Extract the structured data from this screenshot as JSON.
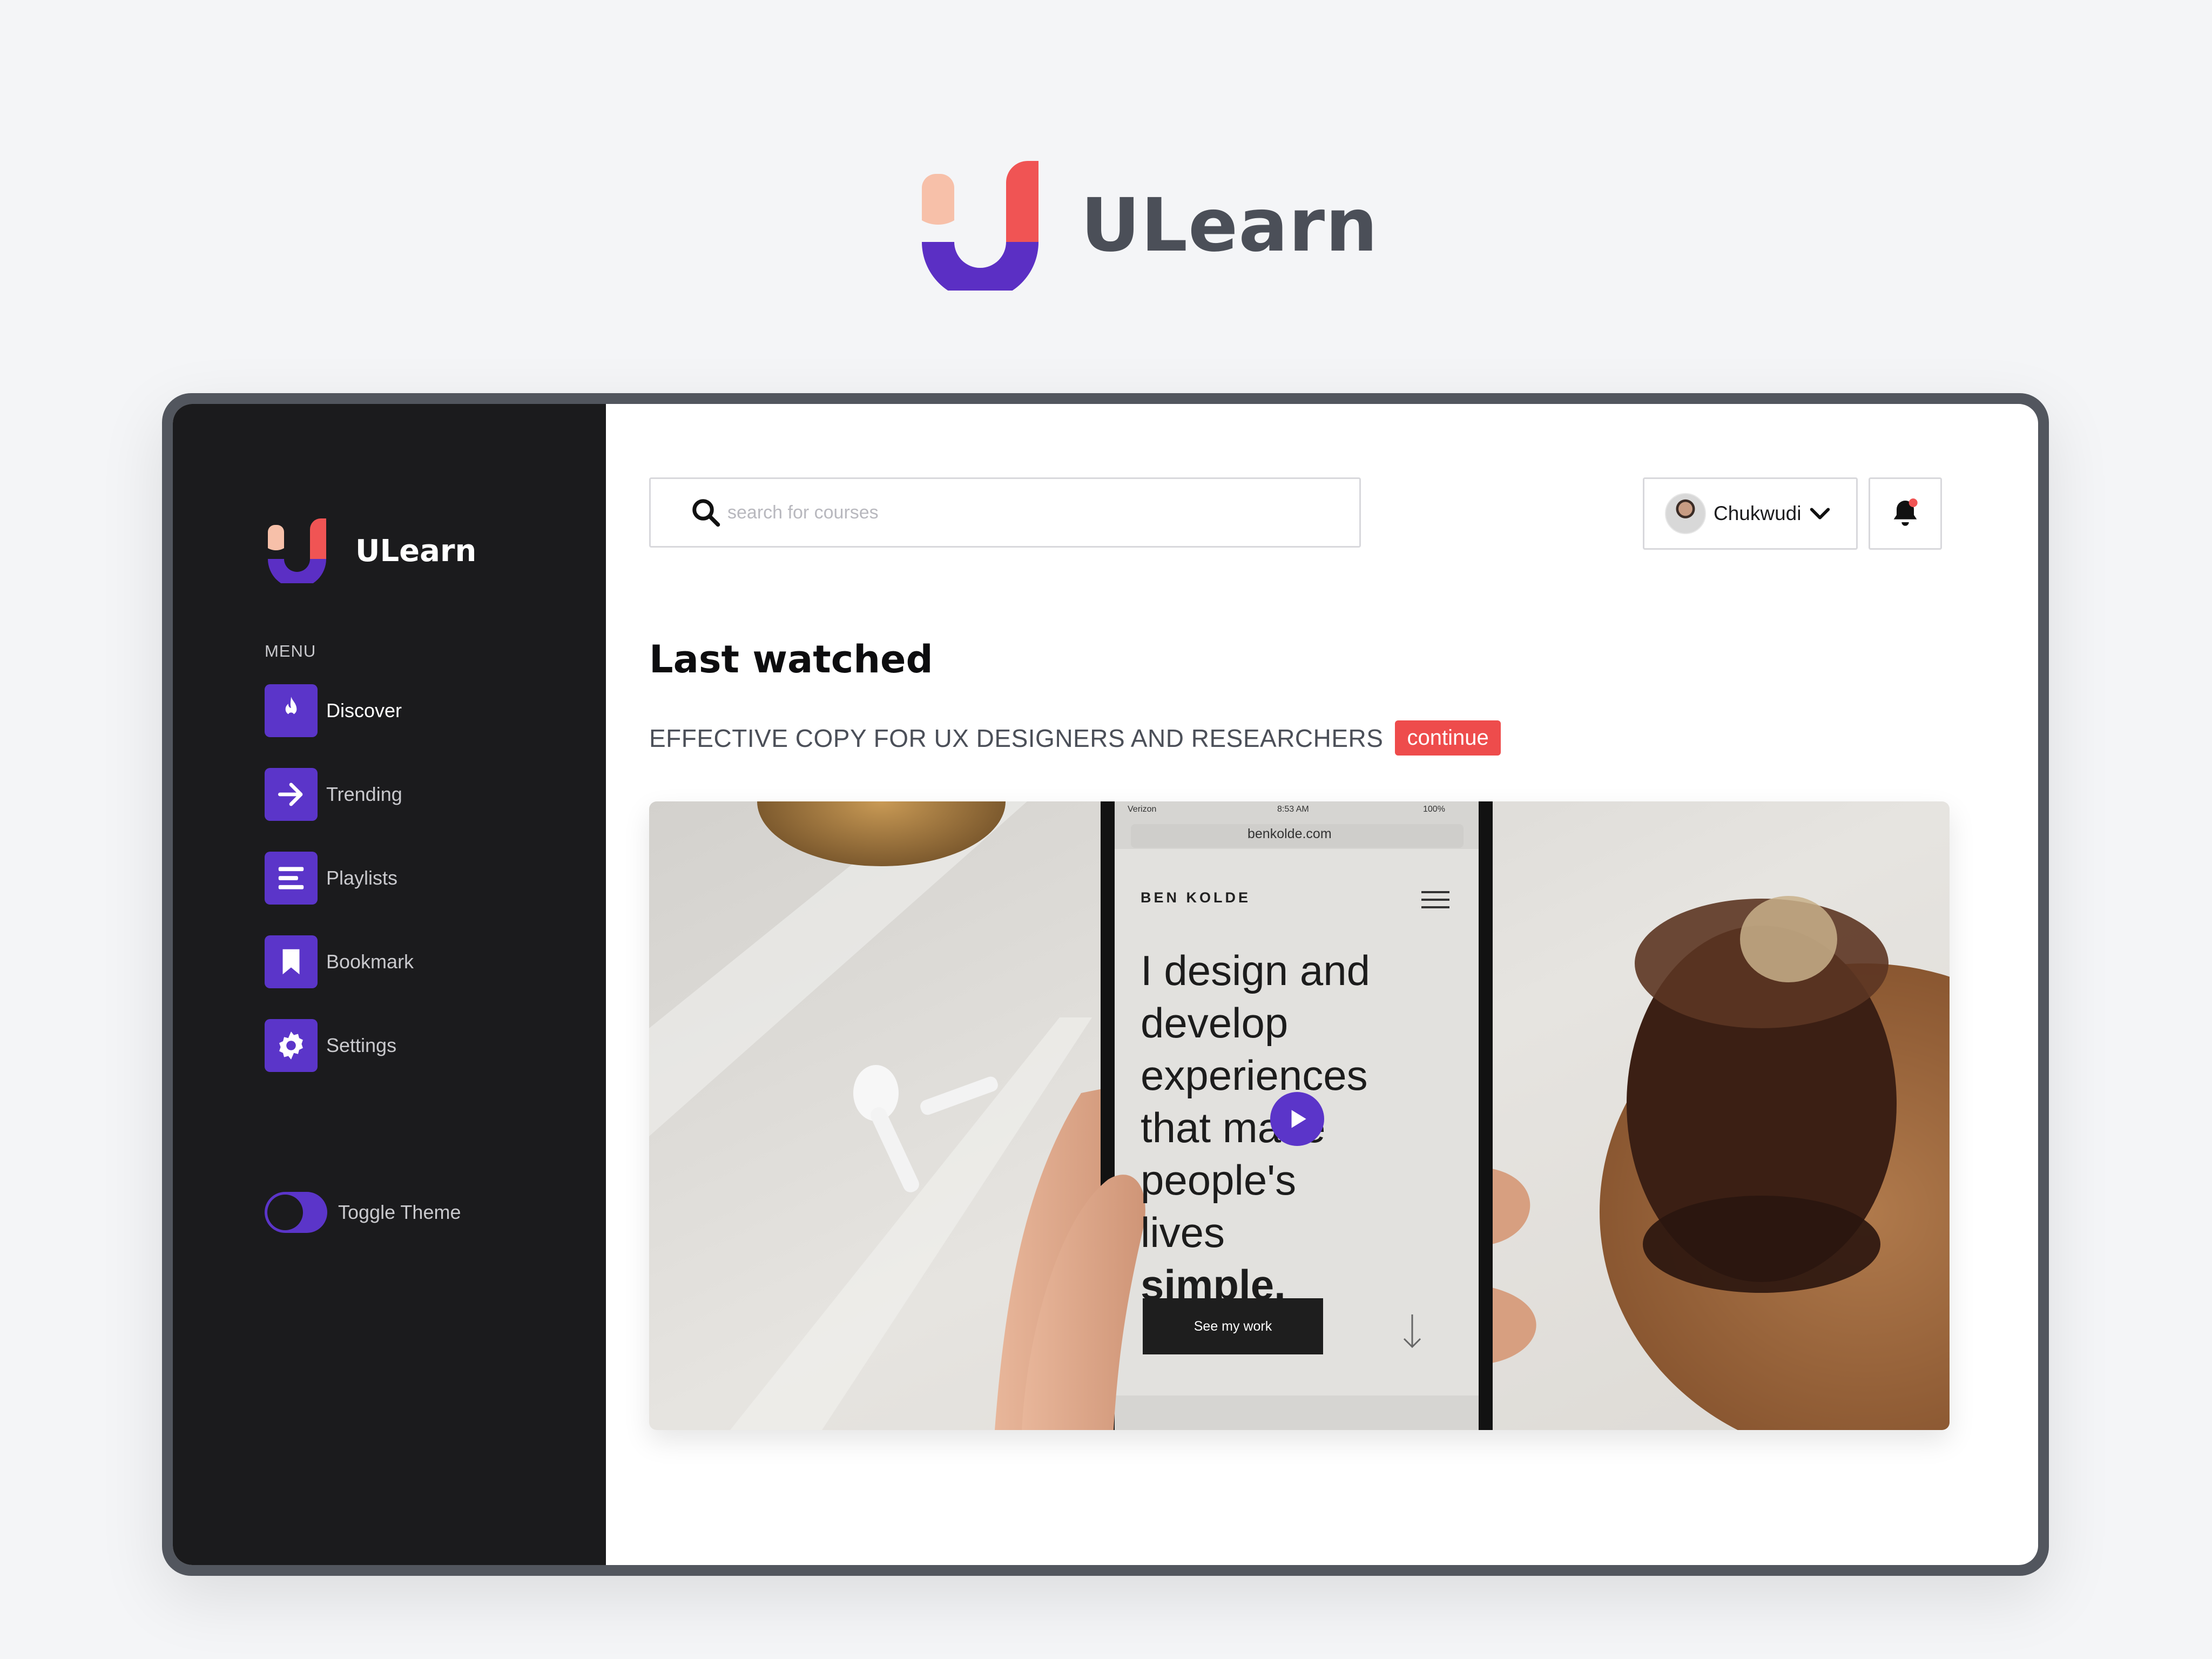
{
  "brand": {
    "name": "ULearn"
  },
  "sidebar": {
    "brand_name": "ULearn",
    "menu_label": "MENU",
    "items": [
      {
        "label": "Discover",
        "icon": "flame-icon",
        "active": true
      },
      {
        "label": "Trending",
        "icon": "arrow-right-icon",
        "active": false
      },
      {
        "label": "Playlists",
        "icon": "list-icon",
        "active": false
      },
      {
        "label": "Bookmark",
        "icon": "bookmark-icon",
        "active": false
      },
      {
        "label": "Settings",
        "icon": "gear-icon",
        "active": false
      }
    ],
    "toggle_label": "Toggle Theme"
  },
  "header": {
    "search_placeholder": "search for courses",
    "user_name": "Chukwudi"
  },
  "main": {
    "section_title": "Last watched",
    "course_title": "EFFECTIVE COPY FOR UX DESIGNERS AND RESEARCHERS",
    "continue_label": "continue"
  },
  "video": {
    "carrier": "Verizon",
    "time": "8:53 AM",
    "battery": "100%",
    "url": "benkolde.com",
    "site_name": "BEN KOLDE",
    "headline": [
      "I design and",
      "develop",
      "experiences",
      "that make",
      "people's lives"
    ],
    "headline_strong": "simple.",
    "cta": "See my work"
  },
  "colors": {
    "accent": "#5b35c9",
    "danger": "#ee4c4c",
    "sidebar_bg": "#1b1b1d",
    "logo_peach": "#f7c0a9",
    "logo_red": "#f05454"
  }
}
